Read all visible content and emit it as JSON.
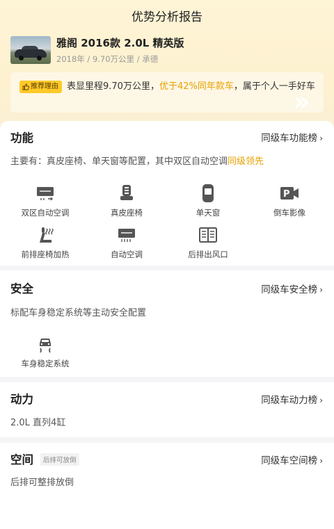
{
  "header": {
    "title": "优势分析报告"
  },
  "car": {
    "name": "雅阁 2016款 2.0L 精英版",
    "meta": "2018年 / 9.70万公里 / 承德"
  },
  "reason": {
    "badge": "推荐理由",
    "text_a": "表显里程9.70万公里，",
    "text_hl": "优于42%同年款车",
    "text_b": "，属于个人一手好车"
  },
  "function": {
    "title": "功能",
    "link": "同级车功能榜",
    "desc_a": "主要有：真皮座椅、单天窗等配置，其中双区自动空调",
    "desc_hl": "同级领先",
    "features": [
      {
        "label": "双区自动空调",
        "icon": "dual-zone-ac-icon"
      },
      {
        "label": "真皮座椅",
        "icon": "leather-seat-icon"
      },
      {
        "label": "单天窗",
        "icon": "sunroof-icon"
      },
      {
        "label": "倒车影像",
        "icon": "reverse-camera-icon"
      },
      {
        "label": "前排座椅加热",
        "icon": "seat-heating-icon"
      },
      {
        "label": "自动空调",
        "icon": "auto-ac-icon"
      },
      {
        "label": "后排出风口",
        "icon": "rear-vent-icon"
      }
    ]
  },
  "safety": {
    "title": "安全",
    "link": "同级车安全榜",
    "desc": "标配车身稳定系统等主动安全配置",
    "features": [
      {
        "label": "车身稳定系统",
        "icon": "stability-control-icon"
      }
    ]
  },
  "power": {
    "title": "动力",
    "link": "同级车动力榜",
    "desc": "2.0L 直列4缸"
  },
  "space": {
    "title": "空间",
    "tag": "后排可放倒",
    "link": "同级车空间榜",
    "desc": "后排可整排放倒"
  },
  "chevron": "›"
}
